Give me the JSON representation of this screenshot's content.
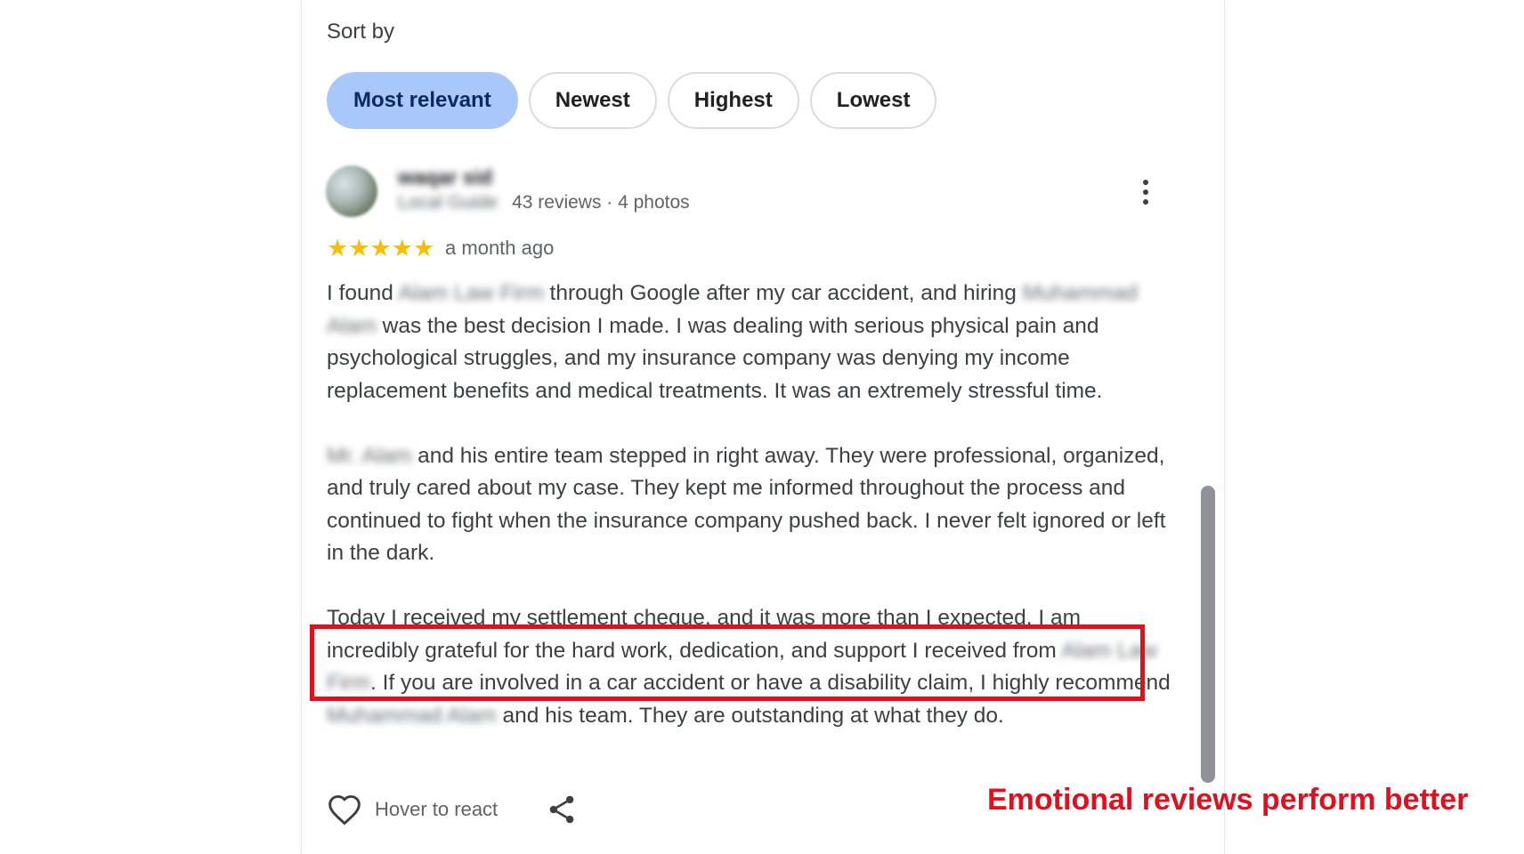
{
  "sort": {
    "label": "Sort by",
    "options": [
      "Most relevant",
      "Newest",
      "Highest",
      "Lowest"
    ],
    "selected": "Most relevant"
  },
  "review": {
    "reviewer_name": "waqar sid",
    "reviewer_badge": "Local Guide",
    "reviewer_stats": "43 reviews · 4 photos",
    "rating": 5,
    "stars": "★★★★★",
    "time": "a month ago",
    "paragraph1": {
      "s1": "I found ",
      "r1": "Alam Law Firm",
      "s2": " through Google after my car accident, and hiring ",
      "r2": "Muhammad Alam",
      "s3": " was the best decision I made. I was dealing with serious physical pain and psychological struggles, and my insurance company was denying my income replacement benefits and medical treatments. It was an extremely stressful time."
    },
    "paragraph2": {
      "r1": "Mr. Alam",
      "s1": " and his entire team stepped in right away. They were professional, organized, and truly cared about my case. They kept me informed throughout the process and continued to fight when the insurance company pushed back. I never felt ignored or left in the dark."
    },
    "paragraph3": {
      "s1": "Today I received my settlement cheque, and it was more than I expected. I am incredibly grateful for the hard work, dedication, and support I received from ",
      "r1": "Alam Law Firm",
      "s2": ". If you are involved in a car accident or have a disability claim, I highly recommend ",
      "r2": "Muhammad Alam",
      "s3": " and his team. They are outstanding at what they do."
    }
  },
  "actions": {
    "react_label": "Hover to react"
  },
  "annotation": "Emotional reviews perform better",
  "colors": {
    "chip_active_bg": "#a8c7fa",
    "star": "#fbbc04",
    "annotation_red": "#e0101e"
  },
  "icons": [
    "more-vert-icon",
    "heart-icon",
    "share-icon"
  ]
}
